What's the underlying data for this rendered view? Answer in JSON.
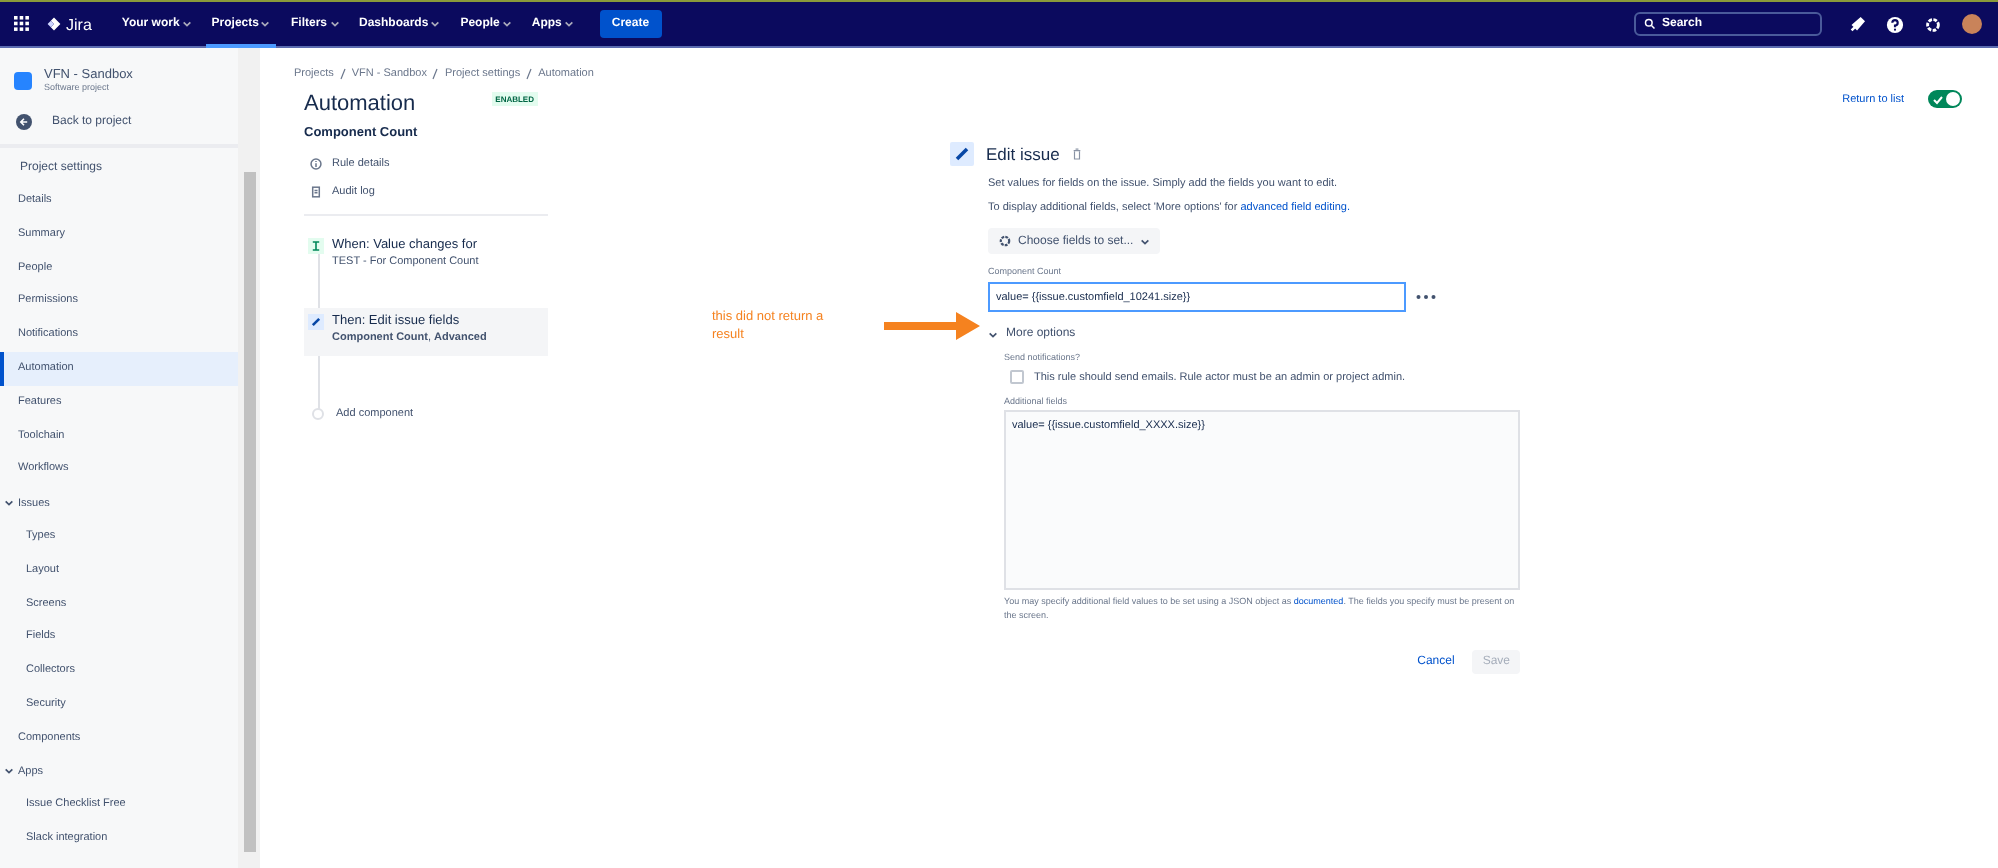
{
  "topnav": {
    "logo": "Jira",
    "menus": [
      {
        "label": "Your work",
        "selected": false
      },
      {
        "label": "Projects",
        "selected": true
      },
      {
        "label": "Filters",
        "selected": false
      },
      {
        "label": "Dashboards",
        "selected": false
      },
      {
        "label": "People",
        "selected": false
      },
      {
        "label": "Apps",
        "selected": false
      }
    ],
    "create": "Create",
    "search": {
      "placeholder": "Search"
    }
  },
  "sidebar": {
    "project": {
      "name": "VFN - Sandbox",
      "type": "Software project"
    },
    "back": "Back to project",
    "heading": "Project settings",
    "items": [
      {
        "label": "Details",
        "selected": false
      },
      {
        "label": "Summary",
        "selected": false
      },
      {
        "label": "People",
        "selected": false
      },
      {
        "label": "Permissions",
        "selected": false
      },
      {
        "label": "Notifications",
        "selected": false
      },
      {
        "label": "Automation",
        "selected": true
      },
      {
        "label": "Features",
        "selected": false
      },
      {
        "label": "Toolchain",
        "selected": false
      },
      {
        "label": "Workflows",
        "selected": false
      },
      {
        "label": "Issues",
        "selected": false,
        "expanded": true,
        "children": [
          {
            "label": "Types",
            "selected": false
          },
          {
            "label": "Layout",
            "selected": false
          },
          {
            "label": "Screens",
            "selected": false
          },
          {
            "label": "Fields",
            "selected": false
          },
          {
            "label": "Collectors",
            "selected": false
          },
          {
            "label": "Security",
            "selected": false
          }
        ]
      },
      {
        "label": "Components",
        "selected": false
      },
      {
        "label": "Apps",
        "selected": false,
        "expanded": true,
        "children": [
          {
            "label": "Issue Checklist Free",
            "selected": false
          },
          {
            "label": "Slack integration",
            "selected": false
          }
        ]
      }
    ]
  },
  "breadcrumbs": [
    "Projects",
    "VFN - Sandbox",
    "Project settings",
    "Automation"
  ],
  "title": "Automation",
  "status": "ENABLED",
  "return_link": "Return to list",
  "rule_enabled": {
    "on": true
  },
  "rule": {
    "name": "Component Count",
    "links": [
      "Rule details",
      "Audit log"
    ],
    "steps": [
      {
        "kind": "trigger",
        "title": "When: Value changes for",
        "detail": "TEST - For Component Count",
        "selected": false
      },
      {
        "kind": "action",
        "title": "Then: Edit issue fields",
        "detail": "**Component Count**, **Advanced**",
        "selected": true
      }
    ],
    "add": "Add component"
  },
  "annotation": "this did not return a result",
  "editor": {
    "title": "Edit issue",
    "desc1": "Set values for fields on the issue. Simply add the fields you want to edit.",
    "desc2": "To display additional fields, select 'More options' for",
    "desc2_link": "advanced field editing.",
    "choose": "Choose fields to set...",
    "field_label": "Component Count",
    "field_value": "value= {{issue.customfield_10241.size}}",
    "more": "More options",
    "more_expanded": true,
    "notify_label": "Send notifications?",
    "notify_text": "This rule should send emails. Rule actor must be an admin or project admin.",
    "notify_checked": false,
    "additional_label": "Additional fields",
    "additional_value": "value= {{issue.customfield_XXXX.size}}",
    "help1": "You may specify additional field values to be set using a JSON object as",
    "help_link": "documented",
    "help2": ". The fields you specify must be present on the screen.",
    "cancel": "Cancel",
    "save": "Save",
    "save_disabled": true
  }
}
